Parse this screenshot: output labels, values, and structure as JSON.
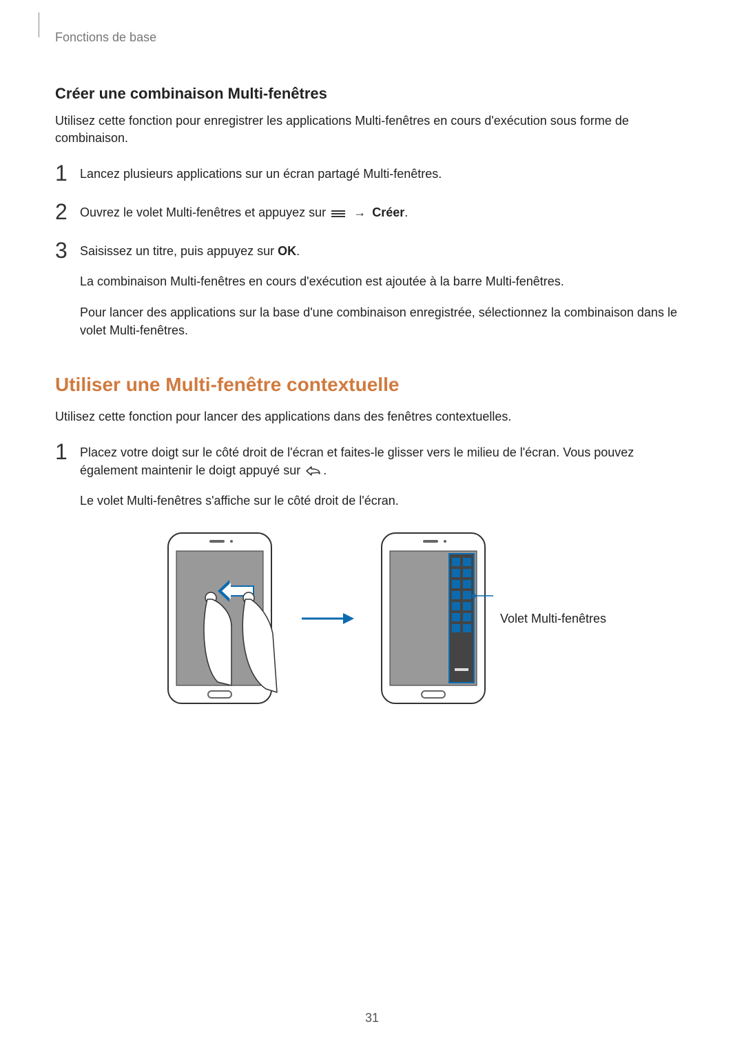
{
  "breadcrumb": "Fonctions de base",
  "section1": {
    "heading": "Créer une combinaison Multi-fenêtres",
    "intro": "Utilisez cette fonction pour enregistrer les applications Multi-fenêtres en cours d'exécution sous forme de combinaison.",
    "steps": [
      {
        "num": "1",
        "line1": "Lancez plusieurs applications sur un écran partagé Multi-fenêtres."
      },
      {
        "num": "2",
        "prefix": "Ouvrez le volet Multi-fenêtres et appuyez sur ",
        "arrow": "→",
        "suffix_bold": "Créer",
        "tail": "."
      },
      {
        "num": "3",
        "line1_prefix": "Saisissez un titre, puis appuyez sur ",
        "line1_bold": "OK",
        "line1_tail": ".",
        "line2": "La combinaison Multi-fenêtres en cours d'exécution est ajoutée à la barre Multi-fenêtres.",
        "line3": "Pour lancer des applications sur la base d'une combinaison enregistrée, sélectionnez la combinaison dans le volet Multi-fenêtres."
      }
    ]
  },
  "section2": {
    "heading": "Utiliser une Multi-fenêtre contextuelle",
    "intro": "Utilisez cette fonction pour lancer des applications dans des fenêtres contextuelles.",
    "step": {
      "num": "1",
      "line1_prefix": "Placez votre doigt sur le côté droit de l'écran et faites-le glisser vers le milieu de l'écran. Vous pouvez également maintenir le doigt appuyé sur ",
      "line1_tail": ".",
      "line2": "Le volet Multi-fenêtres s'affiche sur le côté droit de l'écran."
    },
    "callout": "Volet Multi-fenêtres"
  },
  "page_number": "31"
}
